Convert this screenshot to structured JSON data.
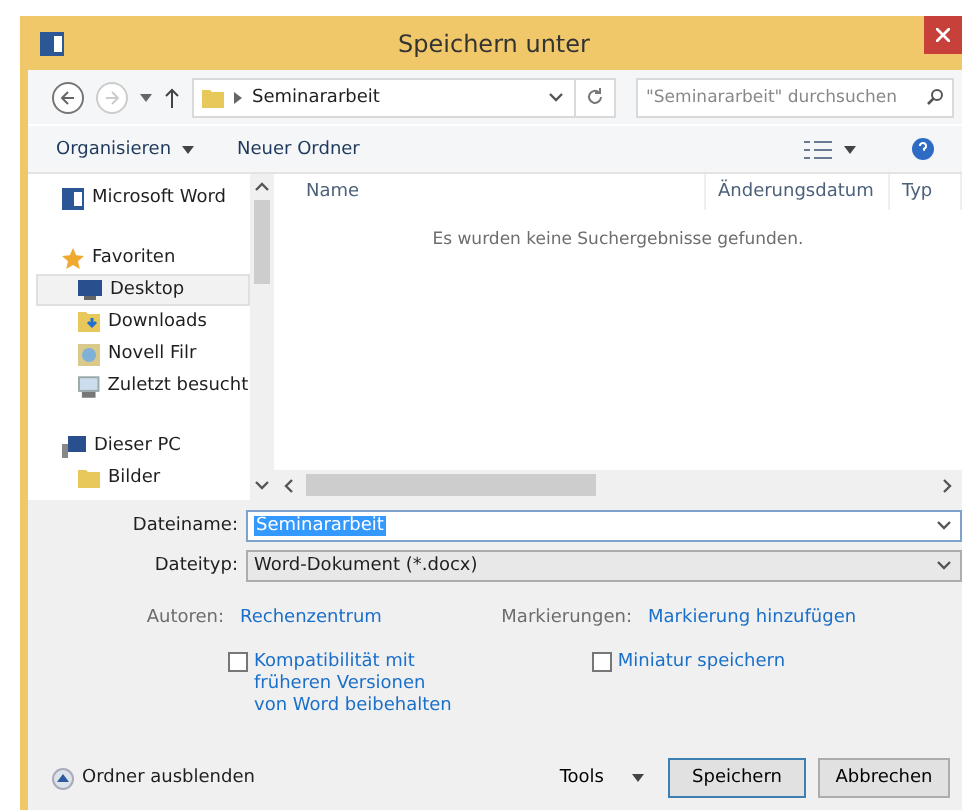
{
  "window": {
    "title": "Speichern unter"
  },
  "address": {
    "path": "Seminararbeit",
    "search_placeholder": "\"Seminararbeit\" durchsuchen"
  },
  "toolbar": {
    "organize": "Organisieren",
    "new_folder": "Neuer Ordner"
  },
  "sidebar": {
    "items": [
      {
        "label": "Microsoft Word",
        "kind": "app",
        "selected": false
      },
      {
        "label": "Favoriten",
        "kind": "group",
        "selected": false
      },
      {
        "label": "Desktop",
        "kind": "desktop",
        "selected": true
      },
      {
        "label": "Downloads",
        "kind": "downloads",
        "selected": false
      },
      {
        "label": "Novell Filr",
        "kind": "filr",
        "selected": false
      },
      {
        "label": "Zuletzt besucht",
        "kind": "recent",
        "selected": false
      },
      {
        "label": "Dieser PC",
        "kind": "pc",
        "selected": false
      },
      {
        "label": "Bilder",
        "kind": "pictures",
        "selected": false
      }
    ]
  },
  "table": {
    "columns": [
      "Name",
      "Änderungsdatum",
      "Typ"
    ],
    "empty_message": "Es wurden keine Suchergebnisse gefunden."
  },
  "form": {
    "filename_label": "Dateiname:",
    "filename": "Seminararbeit",
    "filename_text_selected": true,
    "filetype_label": "Dateityp:",
    "filetype": "Word-Dokument (*.docx)",
    "authors_label": "Autoren:",
    "authors": "Rechenzentrum",
    "tags_label": "Markierungen:",
    "tags": "Markierung hinzufügen"
  },
  "options": [
    {
      "label": "Kompatibilität mit\nfrüheren Versionen\nvon Word beibehalten",
      "checked": false
    },
    {
      "label": "Miniatur speichern",
      "checked": false
    }
  ],
  "footer": {
    "hide_folders": "Ordner ausblenden",
    "tools": "Tools",
    "buttons": [
      {
        "label": "Speichern",
        "default": true
      },
      {
        "label": "Abbrechen",
        "default": false
      }
    ]
  }
}
